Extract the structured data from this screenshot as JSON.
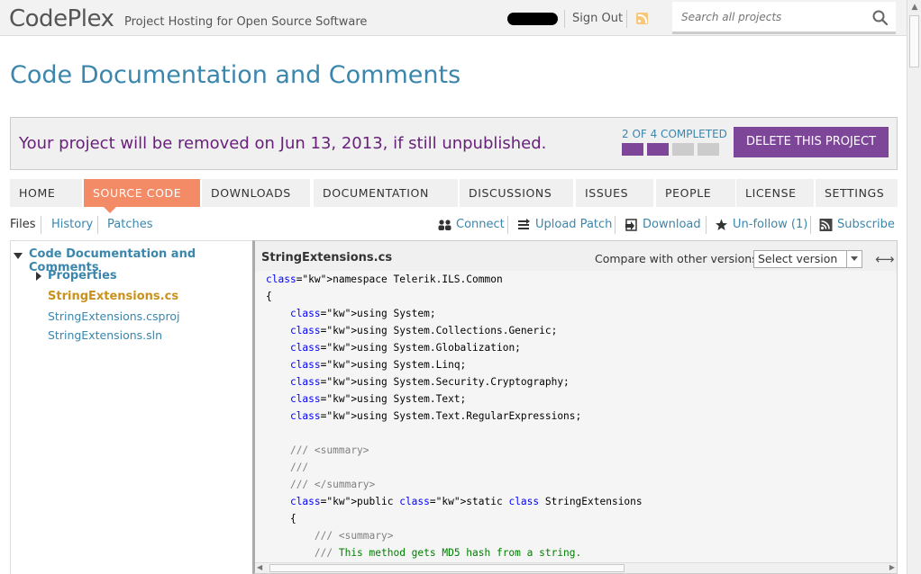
{
  "header": {
    "logo": "CodePlex",
    "tagline": "Project Hosting for Open Source Software",
    "sign_out": "Sign Out",
    "search_placeholder": "Search all projects"
  },
  "page_title": "Code Documentation and Comments",
  "banner": {
    "message": "Your project will be removed on Jun 13, 2013, if still unpublished.",
    "progress_label": "2 OF 4 COMPLETED",
    "steps_completed": 2,
    "steps_total": 4,
    "delete_label": "DELETE THIS PROJECT",
    "colors": {
      "done": "#7d4698",
      "pending": "#cccccc"
    }
  },
  "tabs": [
    {
      "label": "HOME",
      "active": false
    },
    {
      "label": "SOURCE CODE",
      "active": true
    },
    {
      "label": "DOWNLOADS",
      "active": false
    },
    {
      "label": "DOCUMENTATION",
      "active": false
    },
    {
      "label": "DISCUSSIONS",
      "active": false
    },
    {
      "label": "ISSUES",
      "active": false
    },
    {
      "label": "PEOPLE",
      "active": false
    },
    {
      "label": "LICENSE",
      "active": false
    },
    {
      "label": "SETTINGS",
      "active": false
    }
  ],
  "subnav": {
    "files": "Files",
    "history": "History",
    "patches": "Patches",
    "actions": [
      {
        "label": "Connect",
        "icon": "connect-icon"
      },
      {
        "label": "Upload Patch",
        "icon": "upload-patch-icon"
      },
      {
        "label": "Download",
        "icon": "download-icon"
      },
      {
        "label": "Un-follow (1)",
        "icon": "star-icon"
      },
      {
        "label": "Subscribe",
        "icon": "rss-icon"
      }
    ]
  },
  "tree": {
    "root": "Code Documentation and Comments",
    "folder": "Properties",
    "files": [
      {
        "name": "StringExtensions.cs",
        "selected": true
      },
      {
        "name": "StringExtensions.csproj",
        "selected": false
      },
      {
        "name": "StringExtensions.sln",
        "selected": false
      }
    ]
  },
  "code_view": {
    "filename": "StringExtensions.cs",
    "compare_label": "Compare with other versions:",
    "version_selected": "Select version",
    "lines": [
      "namespace Telerik.ILS.Common",
      "{",
      "    using System;",
      "    using System.Collections.Generic;",
      "    using System.Globalization;",
      "    using System.Linq;",
      "    using System.Security.Cryptography;",
      "    using System.Text;",
      "    using System.Text.RegularExpressions;",
      "",
      "    /// <summary>",
      "    ///",
      "    /// </summary>",
      "    public static class StringExtensions",
      "    {",
      "        /// <summary>",
      "        /// This method gets MD5 hash from a string."
    ]
  },
  "colors": {
    "link": "#3a86ad",
    "active_tab": "#f28b66",
    "banner_text": "#68217a",
    "selected_file": "#c9921e"
  }
}
